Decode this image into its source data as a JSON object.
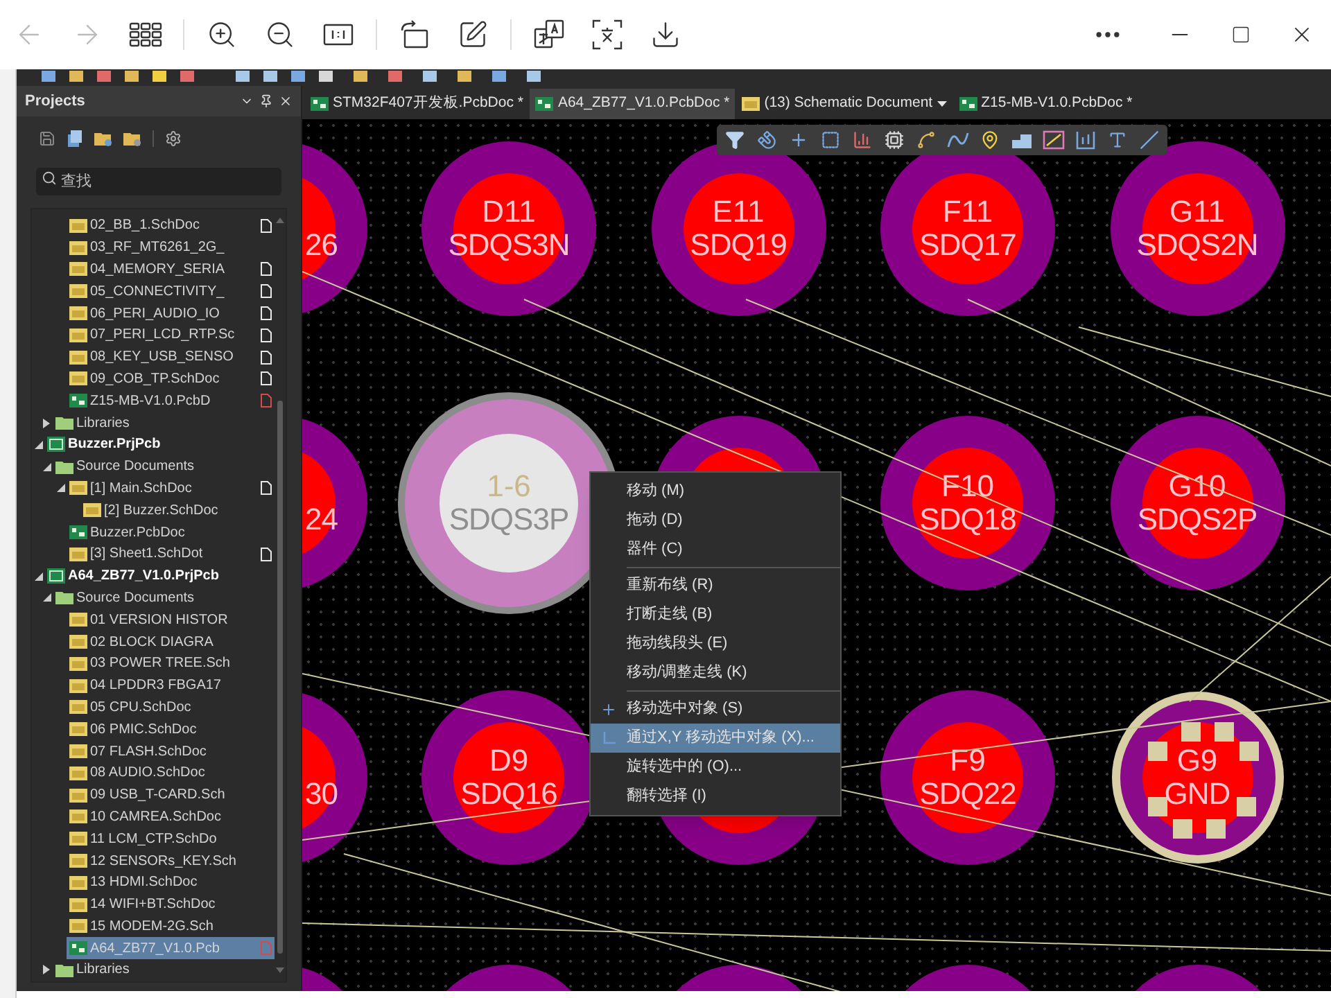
{
  "panel": {
    "title": "Projects",
    "search": {
      "placeholder": "查找"
    },
    "tree": [
      {
        "kind": "continued",
        "children": [
          {
            "kind": "continued",
            "children": [
              {
                "label": "02_BB_1.SchDoc",
                "kind": "schdoc",
                "selected": false,
                "color": "#e8e8e8"
              },
              {
                "label": "03_RF_MT6261_2G_",
                "kind": "schdoc",
                "selected": false
              },
              {
                "label": "04_MEMORY_SERIA",
                "kind": "schdoc",
                "selected": false,
                "color": "#e8e8e8"
              },
              {
                "label": "05_CONNECTIVITY_",
                "kind": "schdoc",
                "selected": false,
                "color": "#e8e8e8"
              },
              {
                "label": "06_PERI_AUDIO_IO",
                "kind": "schdoc",
                "selected": false,
                "color": "#e8e8e8"
              },
              {
                "label": "07_PERI_LCD_RTP.Sc",
                "kind": "schdoc",
                "selected": false,
                "color": "#e8e8e8"
              },
              {
                "label": "08_KEY_USB_SENSO",
                "kind": "schdoc",
                "selected": false,
                "color": "#e8e8e8"
              },
              {
                "label": "09_COB_TP.SchDoc",
                "kind": "schdoc",
                "selected": false,
                "color": "#e8e8e8"
              },
              {
                "label": "Z15-MB-V1.0.PcbD",
                "kind": "pcbdoc",
                "selected": false,
                "color": "#d24b4b"
              }
            ]
          },
          {
            "label": "Libraries",
            "kind": "folder",
            "selected": false,
            "expanded": false
          }
        ]
      },
      {
        "label": "Buzzer.PrjPcb",
        "kind": "project",
        "selected": false,
        "expanded": true,
        "children": [
          {
            "label": "Source Documents",
            "kind": "folder",
            "selected": false,
            "expanded": true,
            "children": [
              {
                "label": "[1] Main.SchDoc",
                "kind": "schdoc",
                "selected": false,
                "color": "#e8e8e8",
                "expanded": true,
                "children": [
                  {
                    "label": "[2] Buzzer.SchDoc",
                    "kind": "schdoc",
                    "selected": false
                  }
                ]
              },
              {
                "label": "Buzzer.PcbDoc",
                "kind": "pcbdoc",
                "selected": false
              },
              {
                "label": "[3] Sheet1.SchDot",
                "kind": "schdoc",
                "selected": false,
                "color": "#e8e8e8"
              }
            ]
          }
        ]
      },
      {
        "label": "A64_ZB77_V1.0.PrjPcb",
        "kind": "project",
        "selected": false,
        "expanded": true,
        "children": [
          {
            "label": "Source Documents",
            "kind": "folder",
            "selected": false,
            "expanded": true,
            "children": [
              {
                "label": "01 VERSION HISTOR",
                "kind": "schdoc",
                "selected": false
              },
              {
                "label": "02 BLOCK DIAGRA",
                "kind": "schdoc",
                "selected": false
              },
              {
                "label": "03 POWER TREE.Sch",
                "kind": "schdoc",
                "selected": false
              },
              {
                "label": "04 LPDDR3 FBGA17",
                "kind": "schdoc",
                "selected": false
              },
              {
                "label": "05 CPU.SchDoc",
                "kind": "schdoc",
                "selected": false
              },
              {
                "label": "06 PMIC.SchDoc",
                "kind": "schdoc",
                "selected": false
              },
              {
                "label": "07 FLASH.SchDoc",
                "kind": "schdoc",
                "selected": false
              },
              {
                "label": "08 AUDIO.SchDoc",
                "kind": "schdoc",
                "selected": false
              },
              {
                "label": "09 USB_T-CARD.Sch",
                "kind": "schdoc",
                "selected": false
              },
              {
                "label": "10 CAMREA.SchDoc",
                "kind": "schdoc",
                "selected": false
              },
              {
                "label": "11 LCM_CTP.SchDo",
                "kind": "schdoc",
                "selected": false
              },
              {
                "label": "12 SENSORs_KEY.Sch",
                "kind": "schdoc",
                "selected": false
              },
              {
                "label": "13 HDMI.SchDoc",
                "kind": "schdoc",
                "selected": false
              },
              {
                "label": "14 WIFI+BT.SchDoc",
                "kind": "schdoc",
                "selected": false
              },
              {
                "label": "15 MODEM-2G.Sch",
                "kind": "schdoc",
                "selected": false
              },
              {
                "label": "A64_ZB77_V1.0.Pcb",
                "kind": "pcbdoc",
                "selected": true,
                "color": "#d24b4b"
              }
            ]
          },
          {
            "label": "Libraries",
            "kind": "folder",
            "selected": false,
            "expanded": false
          }
        ]
      }
    ]
  },
  "tabs": [
    {
      "label": "STM32F407开发板.PcbDoc *",
      "kind": "pcb",
      "selected": false,
      "dropdown": false
    },
    {
      "label": "A64_ZB77_V1.0.PcbDoc *",
      "kind": "pcb",
      "selected": true,
      "dropdown": false
    },
    {
      "label": "(13) Schematic Document",
      "kind": "schematic",
      "selected": false,
      "dropdown": true
    },
    {
      "label": "Z15-MB-V1.0.PcbDoc *",
      "kind": "pcb",
      "selected": false,
      "dropdown": false
    }
  ],
  "pads": [
    [
      {
        "kind": "pad",
        "selected": false,
        "net": "26"
      },
      {
        "kind": "pad",
        "selected": false,
        "pin": "D11",
        "net": "SDQS3N"
      },
      {
        "kind": "pad",
        "selected": false,
        "pin": "E11",
        "net": "SDQ19"
      },
      {
        "kind": "pad",
        "selected": false,
        "pin": "F11",
        "net": "SDQ17"
      },
      {
        "kind": "pad",
        "selected": false,
        "pin": "G11",
        "net": "SDQS2N"
      }
    ],
    [
      {
        "kind": "pad",
        "selected": false,
        "net": "24"
      },
      {
        "kind": "pad",
        "selected": true,
        "pin": "1-6",
        "net": "SDQS3P"
      },
      {
        "kind": "pad",
        "selected": false
      },
      {
        "kind": "pad",
        "selected": false,
        "pin": "F10",
        "net": "SDQ18"
      },
      {
        "kind": "pad",
        "selected": false,
        "pin": "G10",
        "net": "SDQS2P"
      }
    ],
    [
      {
        "kind": "pad",
        "selected": false,
        "net": "30"
      },
      {
        "kind": "pad",
        "selected": false,
        "pin": "D9",
        "net": "SDQ16"
      },
      {
        "kind": "pad",
        "selected": false
      },
      {
        "kind": "pad",
        "selected": false,
        "pin": "F9",
        "net": "SDQ22"
      },
      {
        "kind": "thermal",
        "selected": false,
        "pin": "G9",
        "net": "GND"
      }
    ],
    [
      {
        "kind": "pad",
        "selected": false
      },
      {
        "kind": "pad",
        "selected": false
      },
      {
        "kind": "pad",
        "selected": false
      },
      {
        "kind": "pad",
        "selected": false
      },
      {
        "kind": "pad",
        "selected": false
      }
    ]
  ],
  "context_menu": {
    "groups": [
      [
        {
          "label": "移动 (M)",
          "kind": "plain",
          "selected": false
        },
        {
          "label": "拖动 (D)",
          "kind": "plain",
          "selected": false
        },
        {
          "label": "器件 (C)",
          "kind": "plain",
          "selected": false
        }
      ],
      [
        {
          "label": "重新布线 (R)",
          "kind": "plain",
          "selected": false
        },
        {
          "label": "打断走线 (B)",
          "kind": "plain",
          "selected": false
        },
        {
          "label": "拖动线段头 (E)",
          "kind": "plain",
          "selected": false
        },
        {
          "label": "移动/调整走线 (K)",
          "kind": "plain",
          "selected": false
        }
      ],
      [
        {
          "label": "移动选中对象 (S)",
          "kind": "cross",
          "selected": false
        },
        {
          "label": "通过X,Y 移动选中对象 (X)...",
          "kind": "axes",
          "selected": true
        },
        {
          "label": "旋转选中的 (O)...",
          "kind": "plain",
          "selected": false
        },
        {
          "label": "翻转选择 (I)",
          "kind": "plain",
          "selected": false
        }
      ]
    ]
  }
}
